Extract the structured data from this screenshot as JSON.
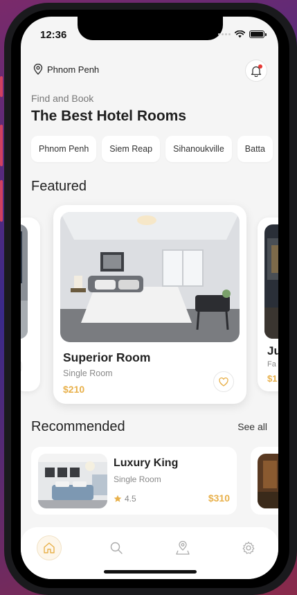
{
  "status": {
    "time": "12:36"
  },
  "header": {
    "location": "Phnom Penh"
  },
  "hero": {
    "subtitle": "Find and Book",
    "title": "The Best Hotel Rooms"
  },
  "cities": [
    "Phnom Penh",
    "Siem Reap",
    "Sihanoukville",
    "Batta"
  ],
  "featured": {
    "title": "Featured",
    "left_partial": {},
    "main": {
      "name": "Superior Room",
      "type": "Single Room",
      "price": "$210"
    },
    "right_partial": {
      "name": "Ju",
      "type": "Fa",
      "price": "$1"
    }
  },
  "recommended": {
    "title": "Recommended",
    "see_all": "See all",
    "items": [
      {
        "name": "Luxury King",
        "type": "Single Room",
        "rating": "4.5",
        "price": "$310"
      }
    ]
  },
  "tabbar": {
    "tabs": [
      {
        "icon": "home-icon",
        "active": true
      },
      {
        "icon": "search-icon",
        "active": false
      },
      {
        "icon": "map-pin-icon",
        "active": false
      },
      {
        "icon": "gear-icon",
        "active": false
      }
    ]
  },
  "colors": {
    "accent": "#e8b04a",
    "notification": "#e53935",
    "background": "#f5f5f5"
  }
}
